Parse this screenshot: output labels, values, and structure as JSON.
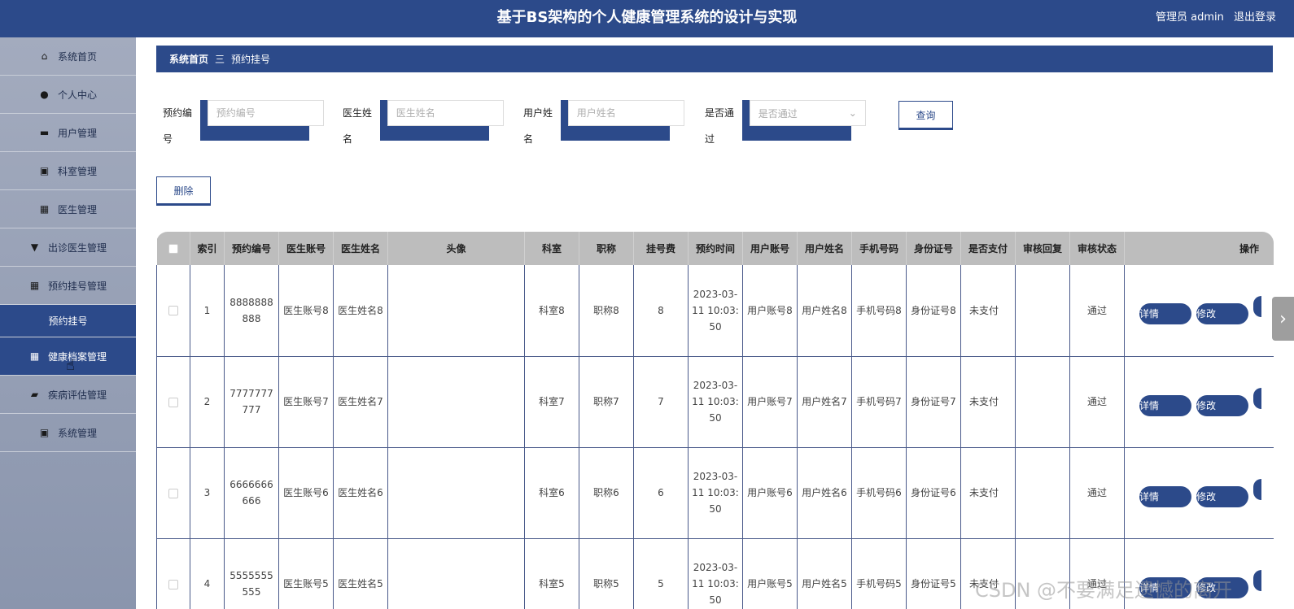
{
  "header": {
    "title": "基于BS架构的个人健康管理系统的设计与实现",
    "user_label": "管理员 admin",
    "logout": "退出登录"
  },
  "sidebar": {
    "items": [
      {
        "label": "系统首页",
        "icon": "home-icon"
      },
      {
        "label": "个人中心",
        "icon": "user-icon"
      },
      {
        "label": "用户管理",
        "icon": "briefcase-icon"
      },
      {
        "label": "科室管理",
        "icon": "clipboard-x-icon"
      },
      {
        "label": "医生管理",
        "icon": "grid-icon"
      },
      {
        "label": "出诊医生管理",
        "icon": "pin-icon"
      },
      {
        "label": "预约挂号管理",
        "icon": "grid-icon"
      },
      {
        "label": "预约挂号",
        "icon": ""
      },
      {
        "label": "健康档案管理",
        "icon": "grid-icon"
      },
      {
        "label": "疾病评估管理",
        "icon": "wallet-icon"
      },
      {
        "label": "系统管理",
        "icon": "clipboard-check-icon"
      }
    ]
  },
  "breadcrumb": {
    "home": "系统首页",
    "sep": "三",
    "current": "预约挂号"
  },
  "search": {
    "f1": {
      "label": "预约编号",
      "placeholder": "预约编号"
    },
    "f2": {
      "label": "医生姓名",
      "placeholder": "医生姓名"
    },
    "f3": {
      "label": "用户姓名",
      "placeholder": "用户姓名"
    },
    "f4": {
      "label": "是否通过",
      "placeholder": "是否通过"
    },
    "query": "查询"
  },
  "delete_label": "删除",
  "table": {
    "headers": [
      "索引",
      "预约编号",
      "医生账号",
      "医生姓名",
      "头像",
      "科室",
      "职称",
      "挂号费",
      "预约时间",
      "用户账号",
      "用户姓名",
      "手机号码",
      "身份证号",
      "是否支付",
      "审核回复",
      "审核状态",
      "操作"
    ],
    "rows": [
      {
        "idx": "1",
        "no": "8888888888",
        "doc_acc": "医生账号8",
        "doc_name": "医生姓名8",
        "dept": "科室8",
        "title": "职称8",
        "fee": "8",
        "time": "2023-03-11 10:03:50",
        "u_acc": "用户账号8",
        "u_name": "用户姓名8",
        "phone": "手机号码8",
        "id": "身份证号8",
        "paid": "未支付",
        "reply": "",
        "status": "通过"
      },
      {
        "idx": "2",
        "no": "7777777777",
        "doc_acc": "医生账号7",
        "doc_name": "医生姓名7",
        "dept": "科室7",
        "title": "职称7",
        "fee": "7",
        "time": "2023-03-11 10:03:50",
        "u_acc": "用户账号7",
        "u_name": "用户姓名7",
        "phone": "手机号码7",
        "id": "身份证号7",
        "paid": "未支付",
        "reply": "",
        "status": "通过"
      },
      {
        "idx": "3",
        "no": "6666666666",
        "doc_acc": "医生账号6",
        "doc_name": "医生姓名6",
        "dept": "科室6",
        "title": "职称6",
        "fee": "6",
        "time": "2023-03-11 10:03:50",
        "u_acc": "用户账号6",
        "u_name": "用户姓名6",
        "phone": "手机号码6",
        "id": "身份证号6",
        "paid": "未支付",
        "reply": "",
        "status": "通过"
      },
      {
        "idx": "4",
        "no": "5555555555",
        "doc_acc": "医生账号5",
        "doc_name": "医生姓名5",
        "dept": "科室5",
        "title": "职称5",
        "fee": "5",
        "time": "2023-03-11 10:03:50",
        "u_acc": "用户账号5",
        "u_name": "用户姓名5",
        "phone": "手机号码5",
        "id": "身份证号5",
        "paid": "未支付",
        "reply": "",
        "status": "通过"
      }
    ],
    "btn_detail": "详情",
    "btn_edit": "修改"
  },
  "watermark": "CSDN @不要满足遗憾的离开",
  "colors": {
    "primary": "#2c4a8a",
    "header_bg": "#bdbdbd"
  }
}
